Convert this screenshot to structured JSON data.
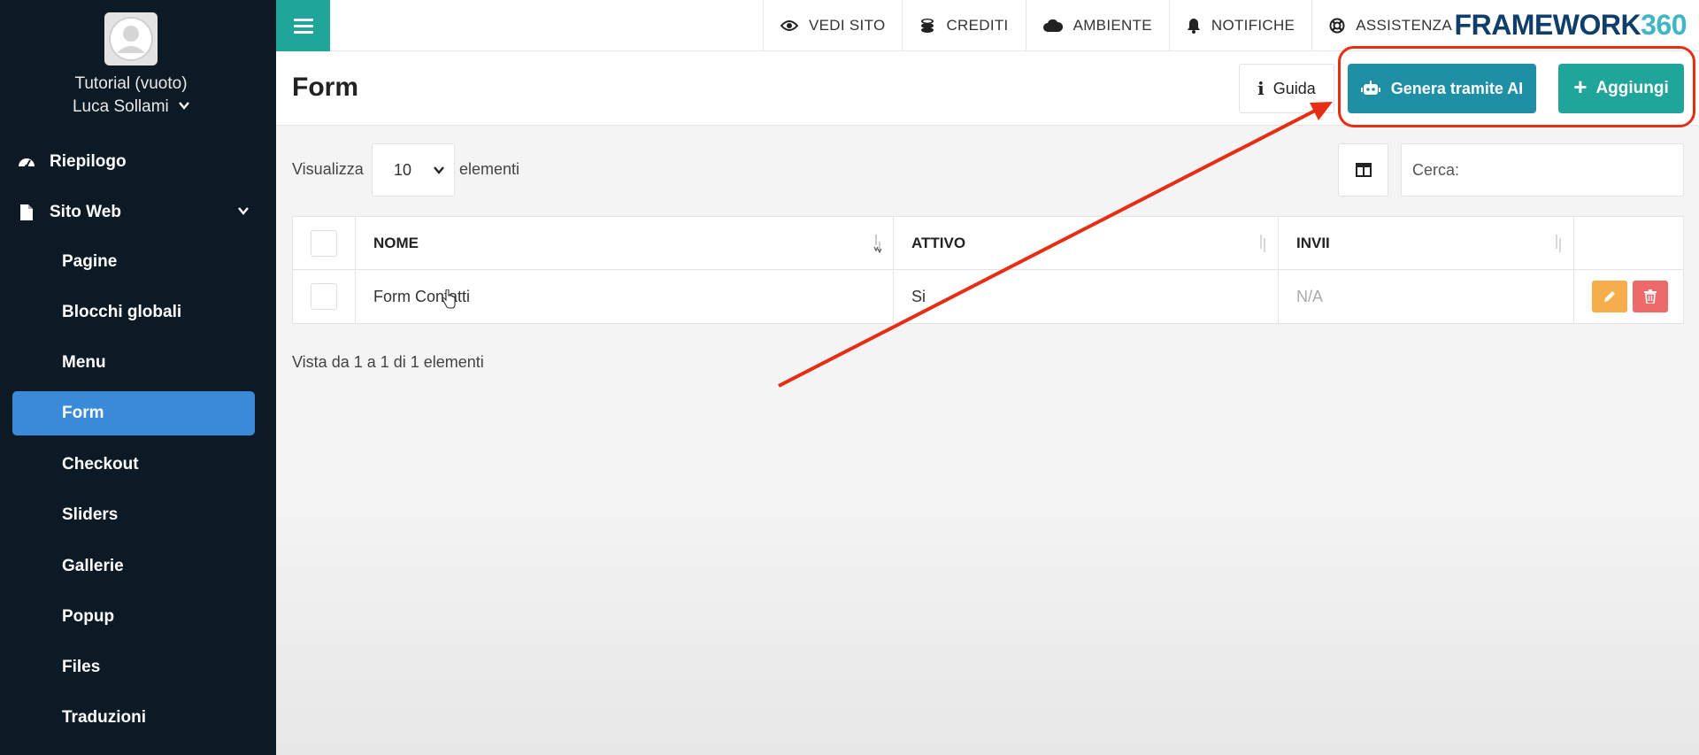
{
  "sidebar": {
    "site_name": "Tutorial (vuoto)",
    "user_name": "Luca Sollami",
    "items": [
      {
        "label": "Riepilogo",
        "icon": "dashboard-icon"
      },
      {
        "label": "Sito Web",
        "icon": "file-icon"
      },
      {
        "label": "Pagine"
      },
      {
        "label": "Blocchi globali"
      },
      {
        "label": "Menu"
      },
      {
        "label": "Form",
        "active": true
      },
      {
        "label": "Checkout"
      },
      {
        "label": "Sliders"
      },
      {
        "label": "Gallerie"
      },
      {
        "label": "Popup"
      },
      {
        "label": "Files"
      },
      {
        "label": "Traduzioni"
      }
    ]
  },
  "topbar": {
    "items": [
      {
        "label": "VEDI SITO",
        "icon": "eye-icon"
      },
      {
        "label": "CREDITI",
        "icon": "coins-icon"
      },
      {
        "label": "AMBIENTE",
        "icon": "cloud-icon"
      },
      {
        "label": "NOTIFICHE",
        "icon": "bell-icon"
      },
      {
        "label": "ASSISTENZA",
        "icon": "lifebuoy-icon"
      }
    ],
    "logo_text": "FRAMEWORK",
    "logo_num": "360"
  },
  "page": {
    "title": "Form",
    "guida_label": "Guida",
    "ai_label": "Genera tramite AI",
    "add_label": "Aggiungi"
  },
  "controls": {
    "show_label": "Visualizza",
    "page_size": "10",
    "elements_label": "elementi",
    "search_label": "Cerca:"
  },
  "table": {
    "columns": [
      "NOME",
      "ATTIVO",
      "INVII"
    ],
    "rows": [
      {
        "nome": "Form Contatti",
        "attivo": "Si",
        "invii": "N/A"
      }
    ],
    "info": "Vista da 1 a 1 di 1 elementi"
  },
  "colors": {
    "sidebar_bg": "#0c1a26",
    "accent_teal": "#1fa59a",
    "accent_blue": "#1f8fa6",
    "active_nav": "#3a8ad8",
    "annotation_red": "#e62e14"
  }
}
